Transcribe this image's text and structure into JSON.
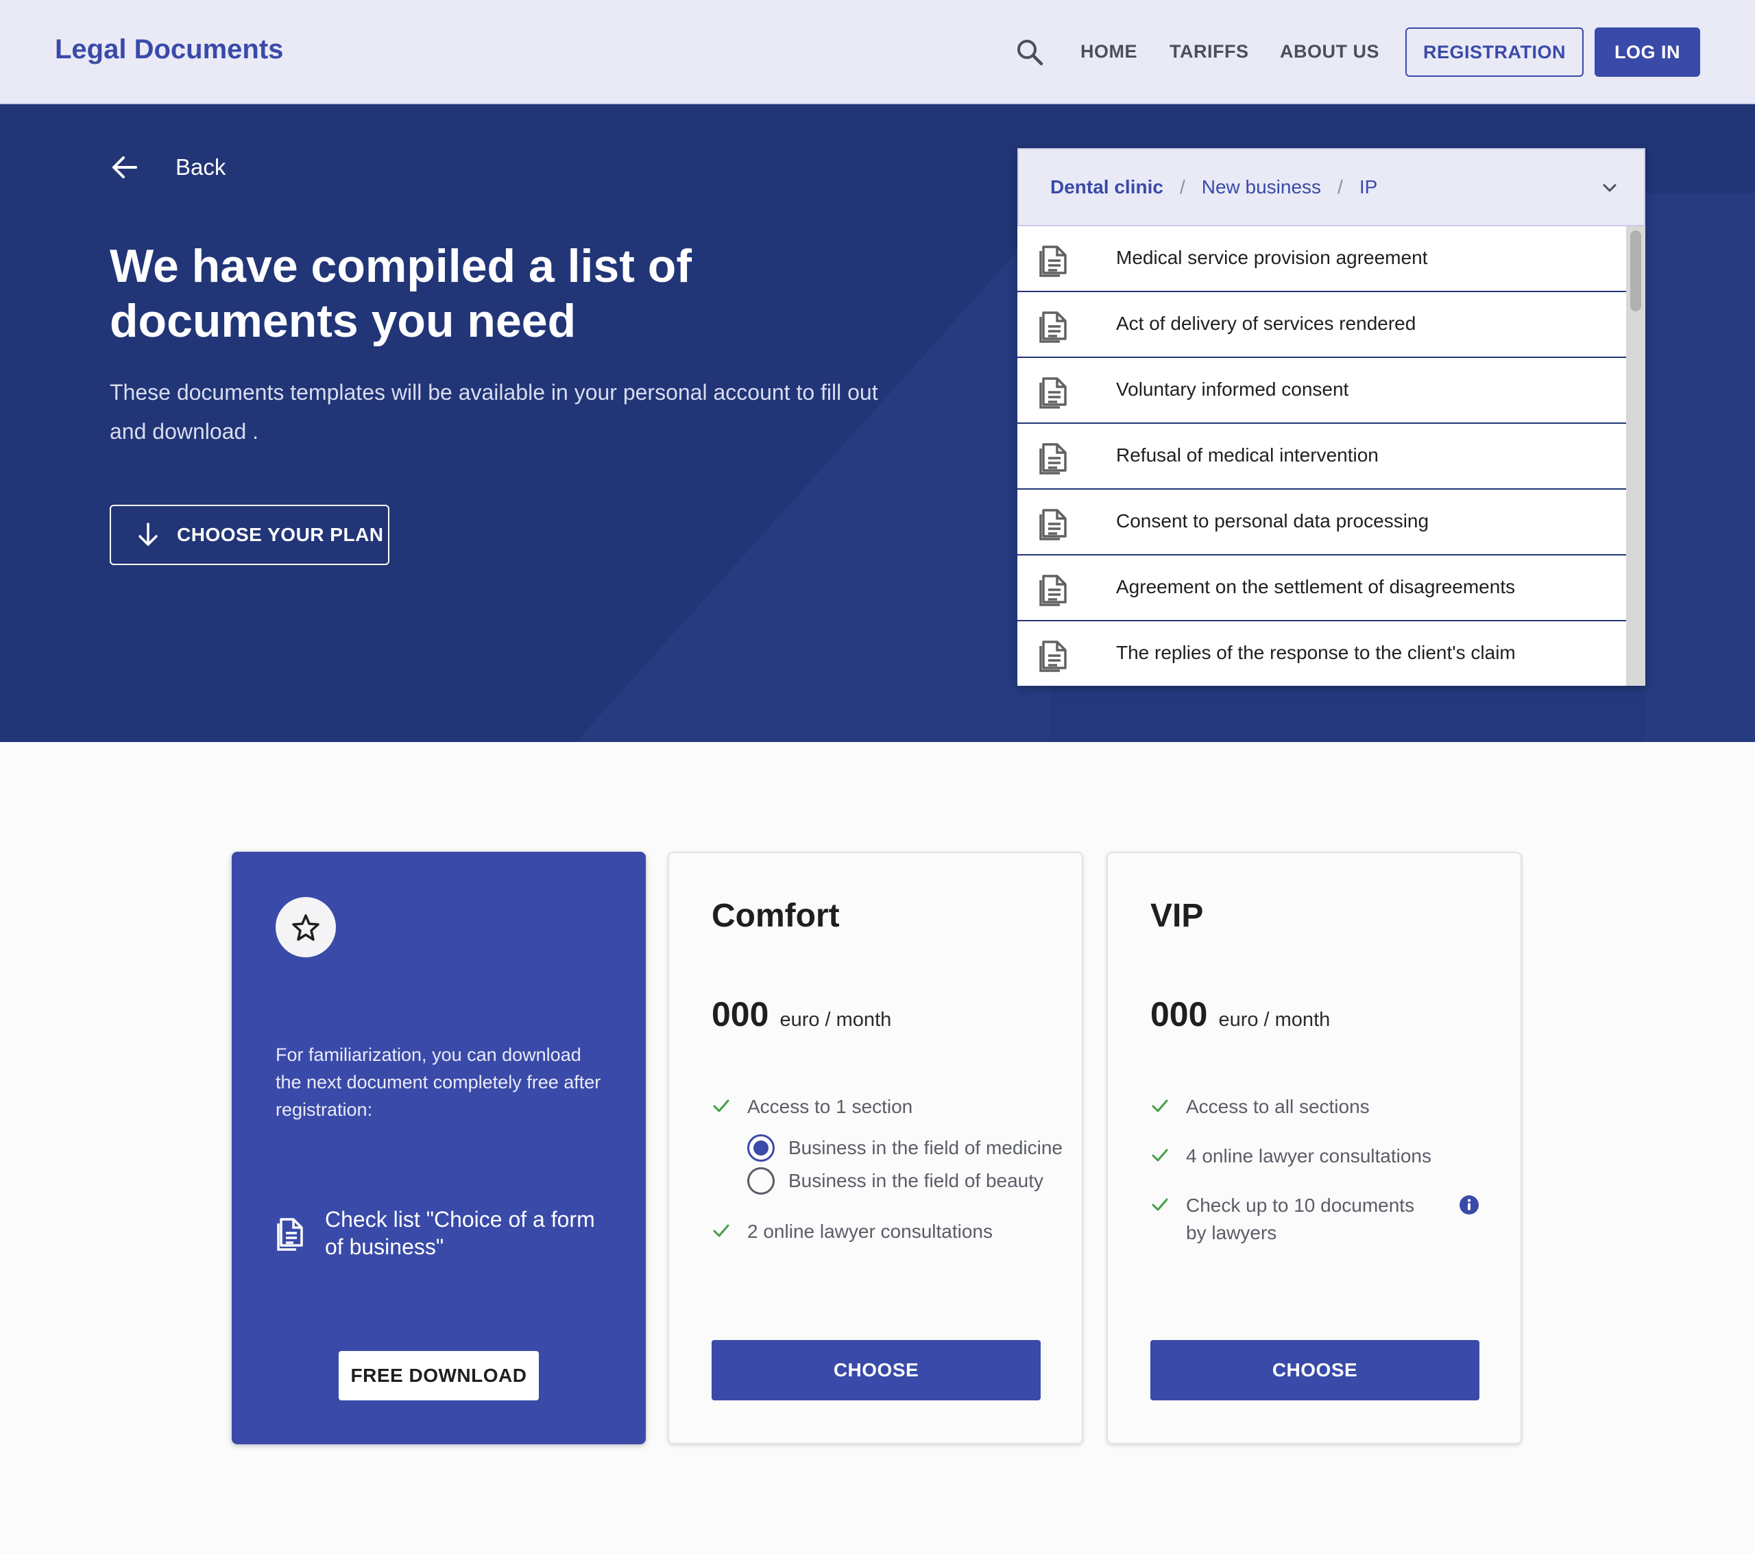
{
  "header": {
    "logo": "Legal Documents",
    "nav": {
      "home": "HOME",
      "tariffs": "TARIFFS",
      "about": "ABOUT US"
    },
    "registration": "REGISTRATION",
    "login": "LOG IN"
  },
  "hero": {
    "back": "Back",
    "title": "We have compiled a list of documents you need",
    "subtitle": "These documents templates will be available in your personal account to fill out and download .",
    "choose_plan": "CHOOSE YOUR PLAN"
  },
  "documents": {
    "breadcrumb": [
      "Dental clinic",
      "New business",
      "IP"
    ],
    "separator": "/",
    "items": [
      "Medical service provision agreement",
      "Act of delivery of services rendered",
      "Voluntary informed consent",
      "Refusal of medical intervention",
      "Consent to personal data processing",
      "Agreement on the settlement of disagreements",
      "The replies of the response to the client's claim"
    ]
  },
  "free_card": {
    "text": "For familiarization, you can download the next document completely free after registration:",
    "doc_title": "Check list \"Choice of a form of business\"",
    "button": "FREE DOWNLOAD"
  },
  "comfort": {
    "name": "Comfort",
    "price": "000",
    "unit": "euro / month",
    "features": [
      "Access to 1 section",
      "2 online lawyer consultations"
    ],
    "options": [
      {
        "label": "Business in the field of medicine",
        "selected": true
      },
      {
        "label": "Business in the field of beauty",
        "selected": false
      }
    ],
    "button": "CHOOSE"
  },
  "vip": {
    "name": "VIP",
    "price": "000",
    "unit": "euro / month",
    "features": [
      "Access to all sections",
      "4 online lawyer consultations",
      "Check up to 10 documents by lawyers"
    ],
    "button": "CHOOSE"
  },
  "colors": {
    "primary": "#3a4aa8",
    "hero_bg": "#213577",
    "header_bg": "#e9eaf6",
    "check_green": "#43a047"
  }
}
